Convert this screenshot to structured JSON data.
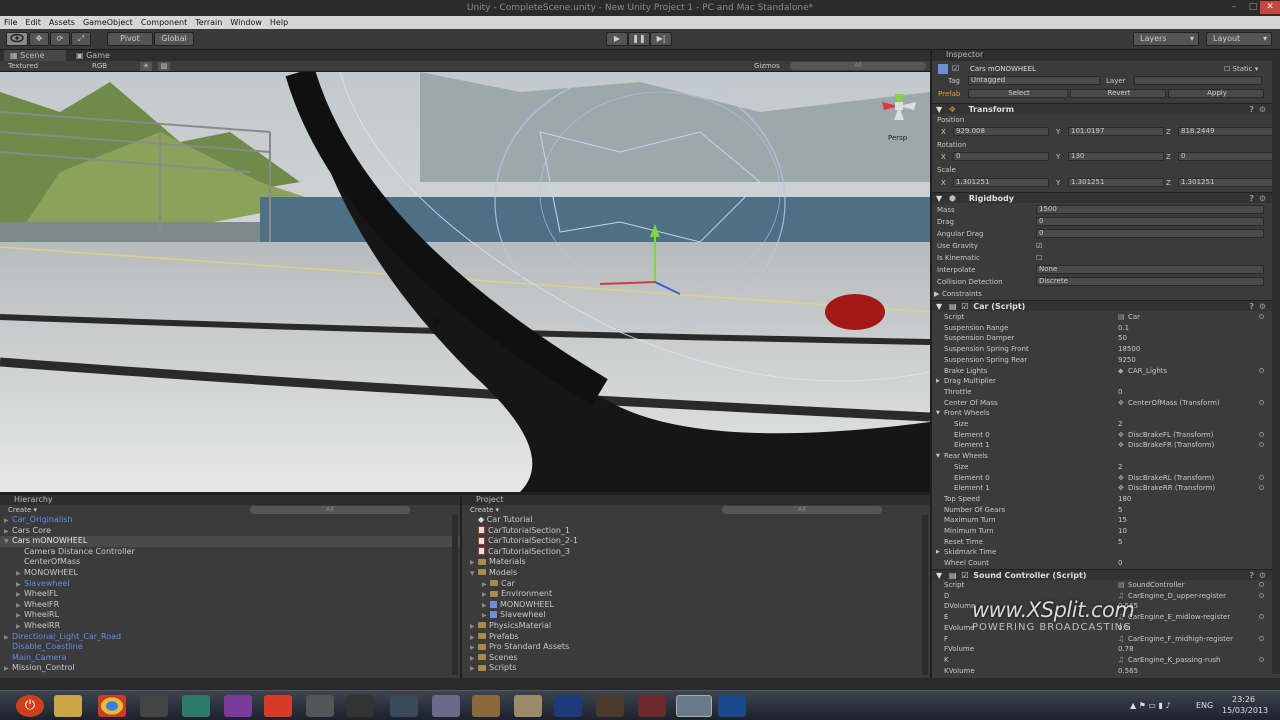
{
  "window": {
    "title": "Unity - CompleteScene.unity - New Unity Project 1 - PC and Mac Standalone*",
    "minimize": "–",
    "maximize": "□",
    "close": "✕"
  },
  "menu": [
    "File",
    "Edit",
    "Assets",
    "GameObject",
    "Component",
    "Terrain",
    "Window",
    "Help"
  ],
  "toolbar": {
    "pivot": "Pivot",
    "global": "Global",
    "layers": "Layers",
    "layout": "Layout"
  },
  "scene": {
    "tab_scene": "Scene",
    "tab_game": "Game",
    "shading": "Textured",
    "render": "RGB",
    "gizmos": "Gizmos",
    "search": "All",
    "persp": "Persp"
  },
  "hierarchy": {
    "title": "Hierarchy",
    "create": "Create",
    "search": "All",
    "items": [
      {
        "label": "Car_Originalish",
        "indent": 0,
        "arrow": "▶",
        "style": "blue"
      },
      {
        "label": "Cars Core",
        "indent": 0,
        "arrow": "▶",
        "style": "normal"
      },
      {
        "label": "Cars mONOWHEEL",
        "indent": 0,
        "arrow": "▼",
        "style": "sel"
      },
      {
        "label": "Camera Distance Controller",
        "indent": 1,
        "arrow": "",
        "style": "normal"
      },
      {
        "label": "CenterOfMass",
        "indent": 1,
        "arrow": "",
        "style": "normal"
      },
      {
        "label": "MONOWHEEL",
        "indent": 1,
        "arrow": "▶",
        "style": "normal"
      },
      {
        "label": "Slavewheel",
        "indent": 1,
        "arrow": "▶",
        "style": "blue"
      },
      {
        "label": "WheelFL",
        "indent": 1,
        "arrow": "▶",
        "style": "normal"
      },
      {
        "label": "WheelFR",
        "indent": 1,
        "arrow": "▶",
        "style": "normal"
      },
      {
        "label": "WheelRL",
        "indent": 1,
        "arrow": "▶",
        "style": "normal"
      },
      {
        "label": "WheelRR",
        "indent": 1,
        "arrow": "▶",
        "style": "normal"
      },
      {
        "label": "Directional_Light_Car_Road",
        "indent": 0,
        "arrow": "▶",
        "style": "blue"
      },
      {
        "label": "Disable_Coastline",
        "indent": 0,
        "arrow": "",
        "style": "blue"
      },
      {
        "label": "Main_Camera",
        "indent": 0,
        "arrow": "",
        "style": "blue"
      },
      {
        "label": "Mission_Control",
        "indent": 0,
        "arrow": "▶",
        "style": "normal"
      }
    ]
  },
  "project": {
    "title": "Project",
    "create": "Create",
    "search": "All",
    "items": [
      {
        "label": "Car Tutorial",
        "indent": 0,
        "kind": "unity",
        "arrow": ""
      },
      {
        "label": "CarTutorialSection_1",
        "indent": 0,
        "kind": "scene",
        "arrow": ""
      },
      {
        "label": "CarTutorialSection_2-1",
        "indent": 0,
        "kind": "scene",
        "arrow": ""
      },
      {
        "label": "CarTutorialSection_3",
        "indent": 0,
        "kind": "scene",
        "arrow": ""
      },
      {
        "label": "Materials",
        "indent": 0,
        "kind": "folder",
        "arrow": "▶"
      },
      {
        "label": "Models",
        "indent": 0,
        "kind": "folder",
        "arrow": "▼"
      },
      {
        "label": "Car",
        "indent": 1,
        "kind": "folder",
        "arrow": "▶"
      },
      {
        "label": "Environment",
        "indent": 1,
        "kind": "folder",
        "arrow": "▶"
      },
      {
        "label": "MONOWHEEL",
        "indent": 1,
        "kind": "model",
        "arrow": "▶"
      },
      {
        "label": "Slavewheel",
        "indent": 1,
        "kind": "model",
        "arrow": "▶"
      },
      {
        "label": "PhysicsMaterial",
        "indent": 0,
        "kind": "folder",
        "arrow": "▶"
      },
      {
        "label": "Prefabs",
        "indent": 0,
        "kind": "folder",
        "arrow": "▶"
      },
      {
        "label": "Pro Standard Assets",
        "indent": 0,
        "kind": "folder",
        "arrow": "▶"
      },
      {
        "label": "Scenes",
        "indent": 0,
        "kind": "folder",
        "arrow": "▶"
      },
      {
        "label": "Scripts",
        "indent": 0,
        "kind": "folder",
        "arrow": "▶"
      }
    ]
  },
  "inspector": {
    "title": "Inspector",
    "object_name": "Cars mONOWHEEL",
    "static": "Static",
    "tag_label": "Tag",
    "tag_value": "Untagged",
    "layer_label": "Layer",
    "prefab_label": "Prefab",
    "prefab_select": "Select",
    "prefab_revert": "Revert",
    "prefab_apply": "Apply",
    "transform": {
      "title": "Transform",
      "position_label": "Position",
      "position": {
        "x": "929.008",
        "y": "101.0197",
        "z": "818.2449"
      },
      "rotation_label": "Rotation",
      "rotation": {
        "x": "0",
        "y": "130",
        "z": "0"
      },
      "scale_label": "Scale",
      "scale": {
        "x": "1.301251",
        "y": "1.301251",
        "z": "1.301251"
      }
    },
    "rigidbody": {
      "title": "Rigidbody",
      "fields": [
        {
          "label": "Mass",
          "value": "1500"
        },
        {
          "label": "Drag",
          "value": "0"
        },
        {
          "label": "Angular Drag",
          "value": "0"
        }
      ],
      "use_gravity": "Use Gravity",
      "is_kinematic": "Is Kinematic",
      "interpolate_label": "Interpolate",
      "interpolate_value": "None",
      "collision_label": "Collision Detection",
      "collision_value": "Discrete",
      "constraints": "Constraints"
    },
    "car_script": {
      "title": "Car (Script)",
      "rows": [
        {
          "label": "Script",
          "value": "Car",
          "icon": "script"
        },
        {
          "label": "Suspension Range",
          "value": "0.1",
          "icon": ""
        },
        {
          "label": "Suspension Damper",
          "value": "50",
          "icon": ""
        },
        {
          "label": "Suspension Spring Front",
          "value": "18500",
          "icon": ""
        },
        {
          "label": "Suspension Spring Rear",
          "value": "9250",
          "icon": ""
        },
        {
          "label": "Brake Lights",
          "value": "CAR_Lights",
          "icon": "obj"
        },
        {
          "label": "Drag Multiplier",
          "value": "",
          "icon": "",
          "arrow": "▶"
        },
        {
          "label": "Throttle",
          "value": "0",
          "icon": ""
        },
        {
          "label": "Center Of Mass",
          "value": "CenterOfMass (Transform)",
          "icon": "tf"
        },
        {
          "label": "Front Wheels",
          "value": "",
          "icon": "",
          "arrow": "▼"
        },
        {
          "label": "Size",
          "value": "2",
          "icon": "",
          "sub": true
        },
        {
          "label": "Element 0",
          "value": "DiscBrakeFL (Transform)",
          "icon": "tf",
          "sub": true
        },
        {
          "label": "Element 1",
          "value": "DiscBrakeFR (Transform)",
          "icon": "tf",
          "sub": true
        },
        {
          "label": "Rear Wheels",
          "value": "",
          "icon": "",
          "arrow": "▼"
        },
        {
          "label": "Size",
          "value": "2",
          "icon": "",
          "sub": true
        },
        {
          "label": "Element 0",
          "value": "DiscBrakeRL (Transform)",
          "icon": "tf",
          "sub": true
        },
        {
          "label": "Element 1",
          "value": "DiscBrakeRR (Transform)",
          "icon": "tf",
          "sub": true
        },
        {
          "label": "Top Speed",
          "value": "180",
          "icon": ""
        },
        {
          "label": "Number Of Gears",
          "value": "5",
          "icon": ""
        },
        {
          "label": "Maximum Turn",
          "value": "15",
          "icon": ""
        },
        {
          "label": "Minimum Turn",
          "value": "10",
          "icon": ""
        },
        {
          "label": "Reset Time",
          "value": "5",
          "icon": ""
        },
        {
          "label": "Skidmark Time",
          "value": "",
          "icon": "",
          "arrow": "▶"
        },
        {
          "label": "Wheel Count",
          "value": "0",
          "icon": ""
        }
      ]
    },
    "sound_script": {
      "title": "Sound Controller (Script)",
      "rows": [
        {
          "label": "Script",
          "value": "SoundController",
          "icon": "script"
        },
        {
          "label": "D",
          "value": "CarEngine_D_upper-register",
          "icon": "audio"
        },
        {
          "label": "DVolume",
          "value": "0.565",
          "icon": ""
        },
        {
          "label": "E",
          "value": "CarEngine_E_midlow-register",
          "icon": "audio"
        },
        {
          "label": "EVolume",
          "value": "0.5",
          "icon": ""
        },
        {
          "label": "F",
          "value": "CarEngine_F_midhigh-register",
          "icon": "audio"
        },
        {
          "label": "FVolume",
          "value": "0.78",
          "icon": ""
        },
        {
          "label": "K",
          "value": "CarEngine_K_passing-rush",
          "icon": "audio"
        },
        {
          "label": "KVolume",
          "value": "0.565",
          "icon": ""
        }
      ]
    }
  },
  "watermark": {
    "line1": "www.XSplit.com",
    "line2": "POWERING BROADCASTING"
  },
  "taskbar": {
    "lang": "ENG",
    "time": "23:26",
    "date": "15/03/2013"
  },
  "colors": {
    "selection": "#4a4a4a",
    "prefab_blue": "#5f8ee6",
    "panel_bg": "#3b3b3b"
  }
}
